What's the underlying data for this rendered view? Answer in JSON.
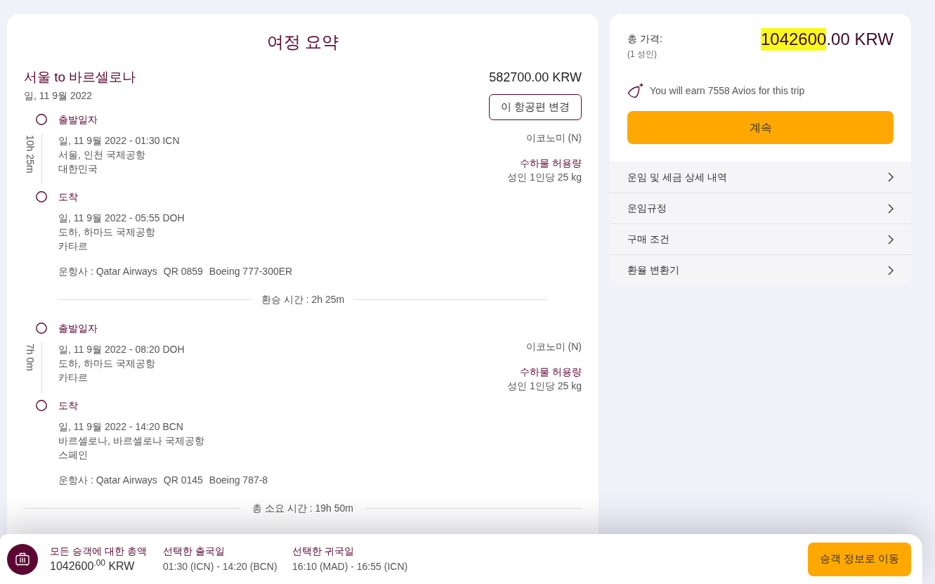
{
  "itinerary": {
    "title": "여정 요약",
    "route": "서울 to 바르셀로나",
    "date": "일, 11 9월 2022",
    "price": "582700.00 KRW",
    "change_button": "이 항공편 변경",
    "segments": [
      {
        "duration": "10h 25m",
        "cabin": "이코노미 (N)",
        "baggage_label": "수하물 허용량",
        "baggage": "성인 1인당 25 kg",
        "stops": [
          {
            "label": "출발일자",
            "lines": [
              "일, 11 9월 2022 - 01:30 ICN",
              "서울, 인천 국제공항",
              "대한민국"
            ]
          },
          {
            "label": "도착",
            "lines": [
              "일, 11 9월 2022 - 05:55 DOH",
              "도하, 하마드 국제공항",
              "카타르"
            ]
          }
        ],
        "operator": "운항사 : Qatar Airways",
        "flight": "QR 0859",
        "aircraft": "Boeing 777-300ER",
        "layover": "환승 시간 : 2h 25m"
      },
      {
        "duration": "7h 0m",
        "cabin": "이코노미 (N)",
        "baggage_label": "수하물 허용량",
        "baggage": "성인 1인당 25 kg",
        "stops": [
          {
            "label": "출발일자",
            "lines": [
              "일, 11 9월 2022 - 08:20 DOH",
              "도하, 하마드 국제공항",
              "카타르"
            ]
          },
          {
            "label": "도착",
            "lines": [
              "일, 11 9월 2022 - 14:20 BCN",
              "바르셀로나, 바르셀로나 국제공항",
              "스페인"
            ]
          }
        ],
        "operator": "운항사 : Qatar Airways",
        "flight": "QR 0145",
        "aircraft": "Boeing 787-8"
      }
    ],
    "total_duration": "총 소요 시간 : 19h 50m"
  },
  "price_summary": {
    "label": "총 가격:",
    "passengers": "(1 성인)",
    "amount_main": "1042600",
    "amount_rest": ".00 KRW",
    "highlighted": true,
    "avios": "You will earn 7558 Avios for this trip",
    "continue_button": "계속",
    "links": [
      "운임 및 세금 상세 내역",
      "운임규정",
      "구매 조건",
      "환율 변환기"
    ]
  },
  "bottom_bar": {
    "total_label": "모든 승객에 대한 총액",
    "total": "1042600$^{.00}$ KRW",
    "outbound_label": "선택한 출국일",
    "outbound": "01:30 (ICN) - 14:20 (BCN)",
    "return_label": "선택한 귀국일",
    "return": "16:10 (MAD) - 16:55 (ICN)",
    "next_button": "승객 정보로 이동"
  }
}
